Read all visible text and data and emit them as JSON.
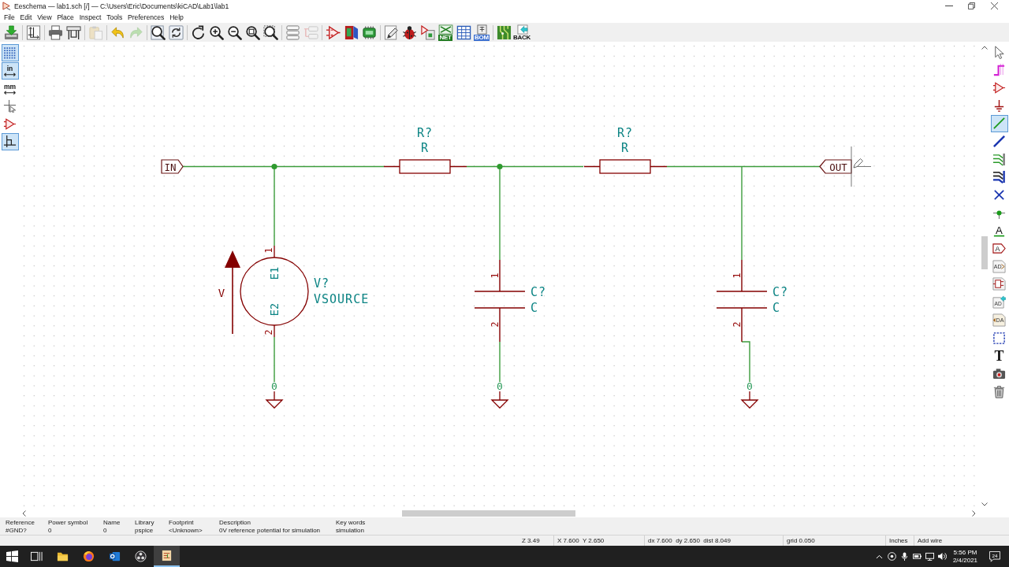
{
  "window": {
    "title": "Eeschema — lab1.sch [/] — C:\\Users\\Eric\\Documents\\kiCAD\\Lab1\\lab1"
  },
  "menu": [
    "File",
    "Edit",
    "View",
    "Place",
    "Inspect",
    "Tools",
    "Preferences",
    "Help"
  ],
  "toolbar": [
    [
      {
        "kind": "save",
        "disabled": false
      }
    ],
    [
      {
        "kind": "page-settings",
        "disabled": false
      }
    ],
    [
      {
        "kind": "print",
        "disabled": false
      },
      {
        "kind": "plot",
        "disabled": false
      }
    ],
    [
      {
        "kind": "paste",
        "disabled": true
      }
    ],
    [
      {
        "kind": "undo",
        "disabled": false
      },
      {
        "kind": "redo",
        "disabled": true
      }
    ],
    [
      {
        "kind": "find",
        "disabled": false
      },
      {
        "kind": "find-replace",
        "disabled": false
      }
    ],
    [
      {
        "kind": "redraw",
        "disabled": false
      },
      {
        "kind": "zoom-in",
        "disabled": false
      },
      {
        "kind": "zoom-out",
        "disabled": false
      },
      {
        "kind": "zoom-fit",
        "disabled": false
      },
      {
        "kind": "zoom-selection",
        "disabled": false
      }
    ],
    [
      {
        "kind": "hierarchy",
        "disabled": false
      },
      {
        "kind": "leave-sheet",
        "disabled": true
      }
    ],
    [
      {
        "kind": "symbol-editor",
        "disabled": false
      },
      {
        "kind": "symbol-library",
        "disabled": false
      },
      {
        "kind": "annotate",
        "disabled": false
      }
    ],
    [
      {
        "kind": "edit-fields",
        "disabled": false
      },
      {
        "kind": "erc",
        "disabled": false
      },
      {
        "kind": "assign-footprints",
        "disabled": false
      },
      {
        "kind": "netlist",
        "label": "NET",
        "disabled": false
      },
      {
        "kind": "field-table",
        "disabled": false
      },
      {
        "kind": "bom",
        "label": "BOM",
        "disabled": false
      }
    ],
    [
      {
        "kind": "pcb",
        "disabled": false
      },
      {
        "kind": "back",
        "label": "BACK",
        "disabled": false
      }
    ]
  ],
  "left_toolbar": [
    {
      "kind": "grid",
      "on": true
    },
    {
      "kind": "units",
      "glyph": "in",
      "on": true
    },
    {
      "kind": "units",
      "glyph": "mm",
      "on": false
    },
    {
      "kind": "cursor",
      "on": false
    },
    {
      "kind": "hidden-pins",
      "on": false
    },
    {
      "kind": "line-mode",
      "on": true
    }
  ],
  "right_toolbar": [
    {
      "kind": "select",
      "on": false
    },
    {
      "kind": "highlight-net",
      "on": false
    },
    {
      "kind": "symbol",
      "on": false
    },
    {
      "kind": "power",
      "on": false
    },
    {
      "kind": "wire",
      "on": true
    },
    {
      "kind": "bus",
      "on": false
    },
    {
      "kind": "wire-entry",
      "on": false
    },
    {
      "kind": "bus-entry",
      "on": false
    },
    {
      "kind": "no-connect",
      "on": false
    },
    {
      "kind": "junction",
      "on": false
    },
    {
      "kind": "net-label",
      "glyph": "A",
      "on": false
    },
    {
      "kind": "global-label",
      "glyph": "A",
      "on": false
    },
    {
      "kind": "hier-label",
      "glyph": "AD",
      "on": false
    },
    {
      "kind": "sheet",
      "on": false
    },
    {
      "kind": "import-pin",
      "glyph": "AD",
      "on": false
    },
    {
      "kind": "hier-pin",
      "glyph": "DA",
      "on": false
    },
    {
      "kind": "lines",
      "on": false
    },
    {
      "kind": "text",
      "glyph": "T",
      "on": false
    },
    {
      "kind": "image",
      "on": false
    },
    {
      "kind": "delete",
      "on": false
    }
  ],
  "schematic": {
    "labels": [
      {
        "kind": "global-input",
        "text": "IN"
      },
      {
        "kind": "global-output",
        "text": "OUT"
      }
    ],
    "symbols": [
      {
        "kind": "resistor",
        "reference": "R?",
        "value": "R"
      },
      {
        "kind": "resistor",
        "reference": "R?",
        "value": "R"
      },
      {
        "kind": "vsource",
        "reference": "V?",
        "value": "VSOURCE",
        "pin_numbers": [
          "1",
          "2"
        ],
        "pin_names": [
          "E1",
          "E2"
        ],
        "arrow_label": "V"
      },
      {
        "kind": "capacitor",
        "reference": "C?",
        "value": "C",
        "pin_numbers": [
          "1",
          "2"
        ]
      },
      {
        "kind": "capacitor",
        "reference": "C?",
        "value": "C",
        "pin_numbers": [
          "1",
          "2"
        ]
      },
      {
        "kind": "ground",
        "value": "0"
      },
      {
        "kind": "ground",
        "value": "0"
      },
      {
        "kind": "ground",
        "value": "0"
      }
    ]
  },
  "message_panel": [
    {
      "label": "Reference",
      "value": "#GND?"
    },
    {
      "label": "Power symbol",
      "value": "0"
    },
    {
      "label": "Name",
      "value": "0"
    },
    {
      "label": "Library",
      "value": "pspice"
    },
    {
      "label": "Footprint",
      "value": "<Unknown>"
    },
    {
      "label": "Description",
      "value": "0V reference potential for simulation"
    },
    {
      "label": "Key words",
      "value": "simulation"
    }
  ],
  "status_bar": [
    "Z 3.49",
    "X 7.600  Y 2.650",
    "dx 7.600  dy 2.650  dist 8.049",
    "grid 0.050",
    "Inches",
    "Add wire"
  ],
  "taskbar": {
    "apps": [
      {
        "kind": "file-explorer",
        "active": false
      },
      {
        "kind": "firefox",
        "active": false
      },
      {
        "kind": "outlook",
        "active": false
      },
      {
        "kind": "obs",
        "active": false
      },
      {
        "kind": "kicad",
        "active": true
      }
    ],
    "time": "5:56 PM",
    "date": "2/4/2021",
    "notifications": "24"
  }
}
